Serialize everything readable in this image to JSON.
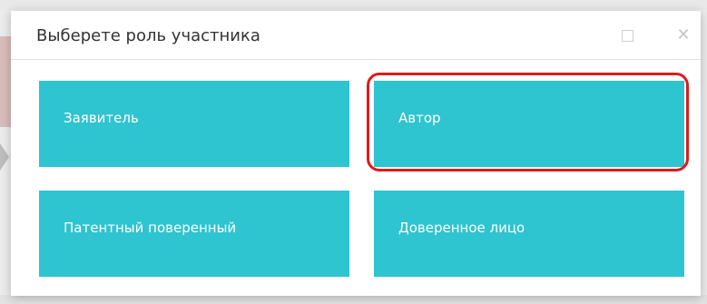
{
  "dialog": {
    "title": "Выберете роль участника",
    "maximize_icon": "square-outline-icon",
    "close_icon": "close-x-icon",
    "close_glyph": "✕"
  },
  "tiles": [
    {
      "label": "Заявитель",
      "color": "#2ec4d0"
    },
    {
      "label": "Автор",
      "color": "#2ec4d0",
      "highlighted": true
    },
    {
      "label": "Патентный поверенный",
      "color": "#2ec4d0"
    },
    {
      "label": "Доверенное лицо",
      "color": "#2ec4d0"
    }
  ],
  "highlight": {
    "color": "#e01a1a",
    "target": "Автор"
  }
}
